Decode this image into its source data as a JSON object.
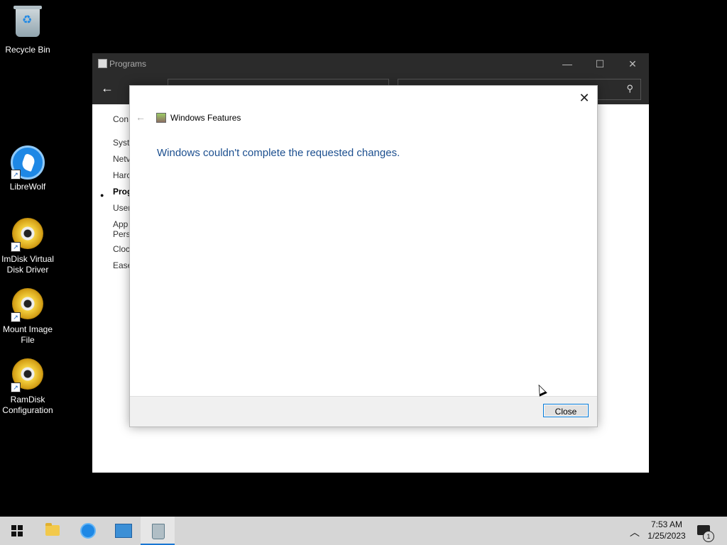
{
  "desktop": {
    "icons": [
      {
        "label": "Recycle Bin",
        "icon": "recycle-bin-icon"
      },
      {
        "label": "LibreWolf",
        "icon": "librewolf-icon"
      },
      {
        "label": "ImDisk Virtual Disk Driver",
        "icon": "disc-icon"
      },
      {
        "label": "Mount Image File",
        "icon": "disc-icon"
      },
      {
        "label": "RamDisk Configuration",
        "icon": "disc-icon"
      }
    ]
  },
  "window": {
    "title": "Programs",
    "sidebar": [
      "Con",
      "Syst",
      "Netv",
      "Harc",
      "Prog",
      "User",
      "App Pers",
      "Cloc",
      "Ease"
    ],
    "active_item": "Prog"
  },
  "dialog": {
    "title": "Windows Features",
    "message": "Windows couldn't complete the requested changes.",
    "close_button": "Close"
  },
  "taskbar": {
    "time": "7:53 AM",
    "date": "1/25/2023",
    "notification_count": "1"
  },
  "colors": {
    "message_text": "#1c4f8f",
    "button_border": "#0078d7"
  }
}
